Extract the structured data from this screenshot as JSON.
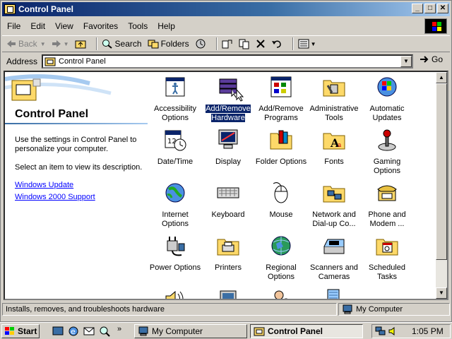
{
  "window": {
    "title": "Control Panel"
  },
  "menu": [
    "File",
    "Edit",
    "View",
    "Favorites",
    "Tools",
    "Help"
  ],
  "toolbar": {
    "back": "Back",
    "search": "Search",
    "folders": "Folders"
  },
  "address": {
    "label": "Address",
    "value": "Control Panel",
    "go": "Go"
  },
  "left": {
    "title": "Control Panel",
    "desc1": "Use the settings in Control Panel to personalize your computer.",
    "desc2": "Select an item to view its description.",
    "link1": "Windows Update",
    "link2": "Windows 2000 Support"
  },
  "items": [
    {
      "l1": "Accessibility",
      "l2": "Options",
      "icon": "accessibility-icon"
    },
    {
      "l1": "Add/Remove",
      "l2": "Hardware",
      "icon": "add-hardware-icon",
      "selected": true
    },
    {
      "l1": "Add/Remove",
      "l2": "Programs",
      "icon": "add-programs-icon"
    },
    {
      "l1": "Administrative",
      "l2": "Tools",
      "icon": "admin-tools-icon"
    },
    {
      "l1": "Automatic",
      "l2": "Updates",
      "icon": "windows-update-icon"
    },
    {
      "l1": "Date/Time",
      "l2": "",
      "icon": "calendar-clock-icon"
    },
    {
      "l1": "Display",
      "l2": "",
      "icon": "monitor-icon"
    },
    {
      "l1": "Folder Options",
      "l2": "",
      "icon": "folder-options-icon"
    },
    {
      "l1": "Fonts",
      "l2": "",
      "icon": "fonts-folder-icon"
    },
    {
      "l1": "Gaming",
      "l2": "Options",
      "icon": "joystick-icon"
    },
    {
      "l1": "Internet",
      "l2": "Options",
      "icon": "globe-icon"
    },
    {
      "l1": "Keyboard",
      "l2": "",
      "icon": "keyboard-icon"
    },
    {
      "l1": "Mouse",
      "l2": "",
      "icon": "mouse-icon"
    },
    {
      "l1": "Network and",
      "l2": "Dial-up Co...",
      "icon": "network-folder-icon"
    },
    {
      "l1": "Phone and",
      "l2": "Modem ...",
      "icon": "phone-icon"
    },
    {
      "l1": "Power Options",
      "l2": "",
      "icon": "power-plug-icon"
    },
    {
      "l1": "Printers",
      "l2": "",
      "icon": "printers-folder-icon"
    },
    {
      "l1": "Regional",
      "l2": "Options",
      "icon": "globe-regional-icon"
    },
    {
      "l1": "Scanners and",
      "l2": "Cameras",
      "icon": "scanner-icon"
    },
    {
      "l1": "Scheduled",
      "l2": "Tasks",
      "icon": "scheduled-tasks-icon"
    },
    {
      "l1": "",
      "l2": "",
      "icon": "sounds-icon"
    },
    {
      "l1": "",
      "l2": "",
      "icon": "system-icon"
    },
    {
      "l1": "",
      "l2": "",
      "icon": "users-icon"
    },
    {
      "l1": "",
      "l2": "",
      "icon": "generic-icon"
    }
  ],
  "status": {
    "text": "Installs, removes, and troubleshoots hardware",
    "zone": "My Computer"
  },
  "taskbar": {
    "start": "Start",
    "task1": "My Computer",
    "task2": "Control Panel",
    "clock": "1:05 PM"
  }
}
